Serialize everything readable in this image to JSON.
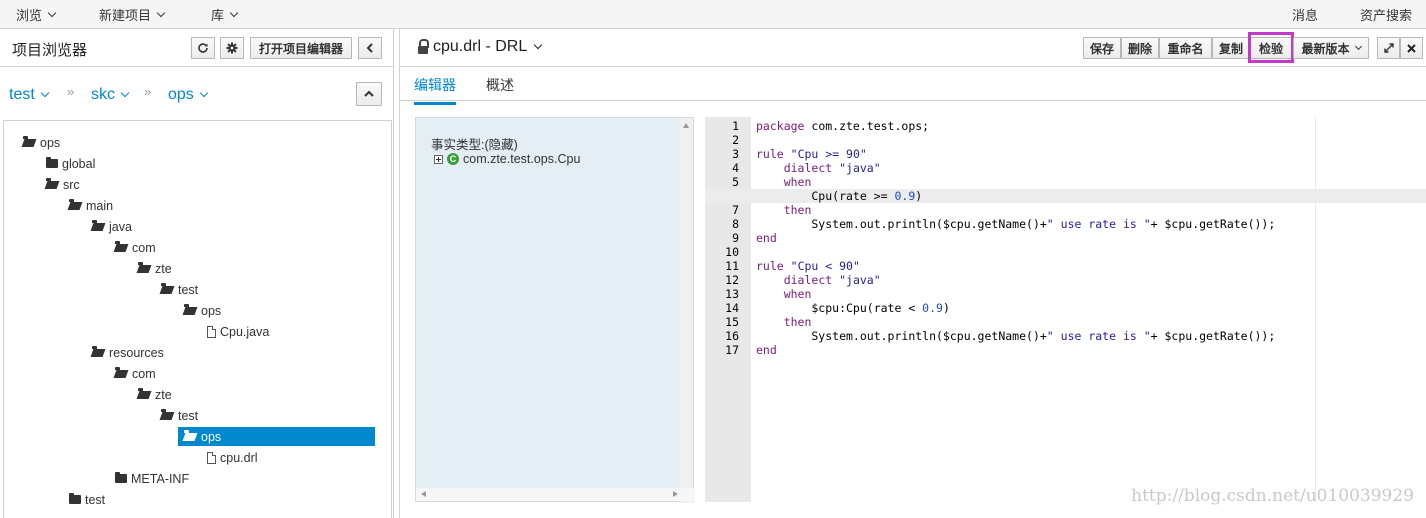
{
  "topnav": {
    "browse": "浏览",
    "new_item": "新建项目",
    "library": "库",
    "messages": "消息",
    "asset_search": "资产搜索"
  },
  "left": {
    "title": "项目浏览器",
    "open_editor_label": "打开项目编辑器",
    "refresh_icon": "refresh-icon",
    "settings_icon": "gear-icon",
    "breadcrumb": [
      "test",
      "skc",
      "ops"
    ],
    "breadcrumb_sep": "»",
    "tree": [
      {
        "label": "ops",
        "type": "folder-open",
        "depth": 0
      },
      {
        "label": "global",
        "type": "folder",
        "depth": 1
      },
      {
        "label": "src",
        "type": "folder-open",
        "depth": 1
      },
      {
        "label": "main",
        "type": "folder-open",
        "depth": 2
      },
      {
        "label": "java",
        "type": "folder-open",
        "depth": 3
      },
      {
        "label": "com",
        "type": "folder-open",
        "depth": 4
      },
      {
        "label": "zte",
        "type": "folder-open",
        "depth": 5
      },
      {
        "label": "test",
        "type": "folder-open",
        "depth": 6
      },
      {
        "label": "ops",
        "type": "folder-open",
        "depth": 7
      },
      {
        "label": "Cpu.java",
        "type": "file",
        "depth": 8
      },
      {
        "label": "resources",
        "type": "folder-open",
        "depth": 3
      },
      {
        "label": "com",
        "type": "folder-open",
        "depth": 4
      },
      {
        "label": "zte",
        "type": "folder-open",
        "depth": 5
      },
      {
        "label": "test",
        "type": "folder-open",
        "depth": 6
      },
      {
        "label": "ops",
        "type": "folder-open",
        "depth": 7,
        "selected": true
      },
      {
        "label": "cpu.drl",
        "type": "file",
        "depth": 8
      },
      {
        "label": "META-INF",
        "type": "folder",
        "depth": 4
      },
      {
        "label": "test",
        "type": "folder",
        "depth": 2
      }
    ]
  },
  "editor": {
    "title": "cpu.drl - DRL",
    "buttons": {
      "save": "保存",
      "delete": "删除",
      "rename": "重命名",
      "copy": "复制",
      "validate": "检验",
      "latest_version": "最新版本"
    },
    "highlight_color": "#c13ac9",
    "tabs": [
      "编辑器",
      "概述"
    ],
    "facts_title": "事实类型:(隐藏)",
    "fact_item": "com.zte.test.ops.Cpu",
    "code": [
      "package com.zte.test.ops;",
      "",
      "rule \"Cpu >= 90\"",
      "    dialect \"java\"",
      "    when",
      "        Cpu(rate >= 0.9)",
      "    then",
      "        System.out.println($cpu.getName()+\" use rate is \"+ $cpu.getRate());",
      "end",
      "",
      "rule \"Cpu < 90\"",
      "    dialect \"java\"",
      "    when",
      "        $cpu:Cpu(rate < 0.9)",
      "    then",
      "        System.out.println($cpu.getName()+\" use rate is \"+ $cpu.getRate());",
      "end"
    ],
    "highlighted_line": 6
  },
  "watermark": "http://blog.csdn.net/u010039929"
}
